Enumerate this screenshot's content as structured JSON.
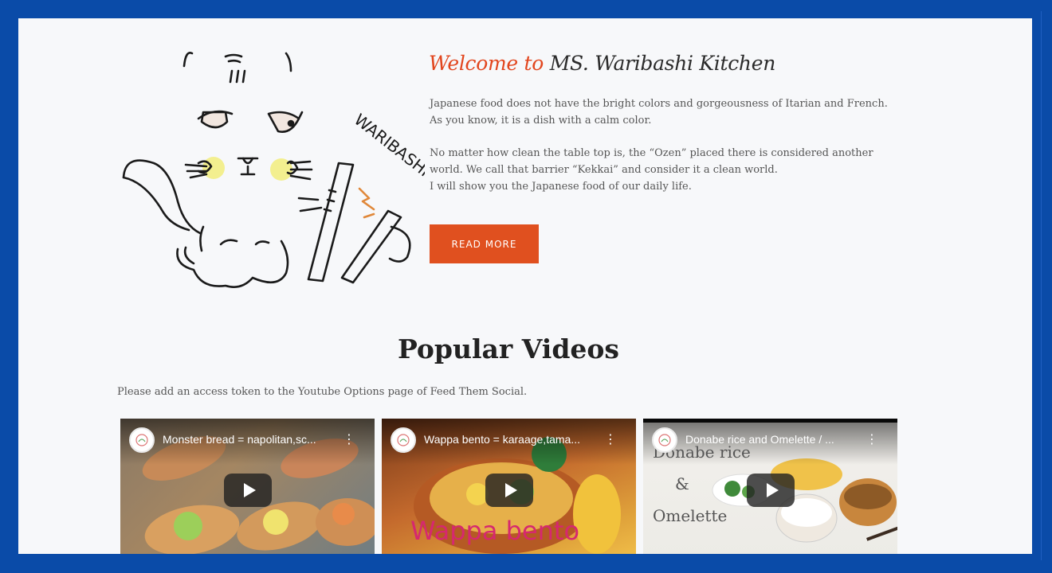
{
  "hero": {
    "welcome_prefix": "Welcome to",
    "welcome_name": "MS. Waribashi Kitchen",
    "illustration_text": "WARIBASHI",
    "paragraph1": "Japanese food does not have the bright colors and gorgeousness of Itarian and French. As you know, it is a dish with a calm color.",
    "paragraph2_line1": "No matter how clean the table top is, the “Ozen” placed there is considered another world. We call that barrier “Kekkai” and consider it a clean world.",
    "paragraph2_line2": "I will show you the Japanese food of our daily life.",
    "read_more_label": "READ MORE"
  },
  "videos_section": {
    "title": "Popular Videos",
    "notice": "Please add an access token to the Youtube Options page of Feed Them Social.",
    "videos": [
      {
        "title": "Monster bread = napolitan,sc...",
        "overlay_text": ""
      },
      {
        "title": "Wappa bento = karaage,tama...",
        "overlay_text": "Wappa  bento"
      },
      {
        "title": "Donabe rice and Omelette / ...",
        "overlay_text_lines": [
          "Donabe rice",
          "&",
          "Omelette"
        ]
      }
    ]
  },
  "colors": {
    "accent": "#e2461e",
    "button": "#e0501f",
    "border_frame": "#0a4ba8",
    "page_bg": "#f7f8fa"
  },
  "icons": [
    "play-icon",
    "more-vert-icon",
    "channel-avatar-icon"
  ]
}
